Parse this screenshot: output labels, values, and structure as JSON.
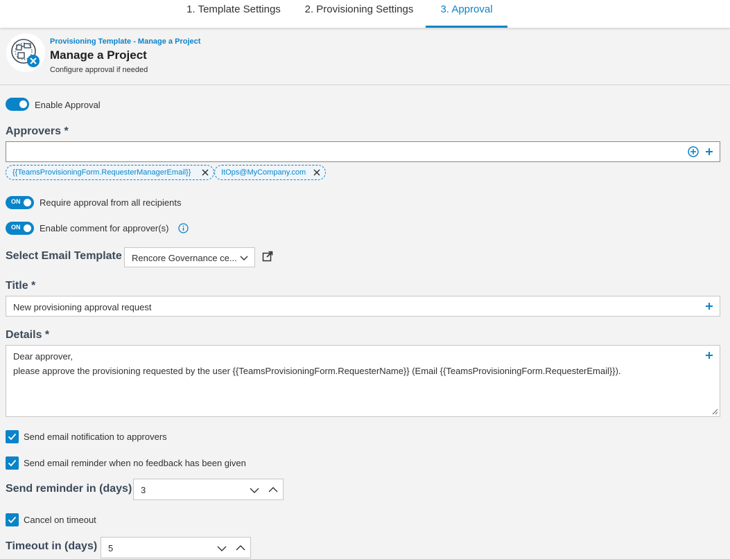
{
  "wizard": {
    "tabs": [
      {
        "label": "1. Template Settings"
      },
      {
        "label": "2. Provisioning Settings"
      },
      {
        "label": "3. Approval"
      }
    ]
  },
  "header": {
    "breadcrumb": "Provisioning Template - Manage a Project",
    "title": "Manage a Project",
    "subtitle": "Configure approval if needed"
  },
  "approval": {
    "enable_label": "Enable Approval",
    "approvers_label": "Approvers *",
    "approvers_input_value": "",
    "approvers": [
      {
        "label": "{{TeamsProvisioningForm.RequesterManagerEmail}}"
      },
      {
        "label": "ItOps@MyCompany.com"
      }
    ],
    "require_all": {
      "toggle_text": "ON",
      "label": "Require approval from all recipients"
    },
    "enable_comment": {
      "toggle_text": "ON",
      "label": "Enable comment for approver(s)"
    },
    "email_template": {
      "label": "Select Email Template",
      "value": "Rencore Governance ce..."
    },
    "title_field": {
      "label": "Title *",
      "value": "New provisioning approval request"
    },
    "details": {
      "label": "Details *",
      "line1": "Dear approver,",
      "line2": "please approve the provisioning requested by the user {{TeamsProvisioningForm.RequesterName}} (Email {{TeamsProvisioningForm.RequesterEmail}})."
    },
    "send_notification": {
      "label": "Send email notification to approvers",
      "checked": true
    },
    "send_reminder": {
      "label": "Send email reminder when no feedback has been given",
      "checked": true
    },
    "reminder_days": {
      "label": "Send reminder in (days)",
      "value": "3"
    },
    "cancel_on_timeout": {
      "label": "Cancel on timeout",
      "checked": true
    },
    "timeout_days": {
      "label": "Timeout in (days)",
      "value": "5"
    }
  },
  "colors": {
    "accent": "#0a84c9",
    "background": "#f3f3f3",
    "section_label": "#3b4a5a"
  },
  "icons": [
    "template-logo-icon",
    "add-circle-icon",
    "plus-icon",
    "close-icon",
    "info-icon",
    "chevron-down-icon",
    "chevron-up-icon",
    "external-link-icon",
    "check-icon",
    "resize-grip-icon"
  ]
}
